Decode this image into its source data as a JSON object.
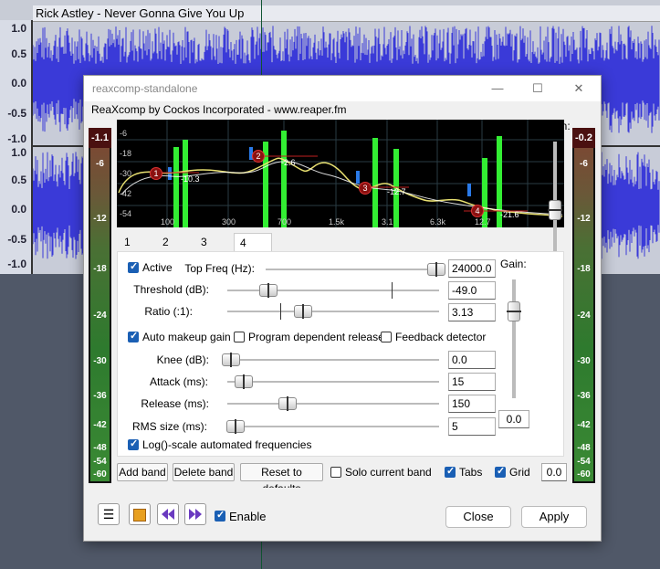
{
  "daw": {
    "track_title": "Rick Astley - Never Gonna Give You Up",
    "scale": [
      "1.0",
      "0.5",
      "0.0",
      "-0.5",
      "-1.0",
      "1.0",
      "0.5",
      "0.0",
      "-0.5",
      "-1.0"
    ]
  },
  "window": {
    "title": "reaxcomp-standalone",
    "minimize_glyph": "—",
    "maximize_glyph": "☐",
    "close_glyph": "✕",
    "subtitle": "ReaXcomp by Cockos Incorporated - www.reaper.fm"
  },
  "meters": {
    "left_top": "-1.1",
    "right_top": "-0.2",
    "labels": [
      "-6",
      "-12",
      "-18",
      "-24",
      "-30",
      "-36",
      "-42",
      "-48",
      "-54",
      "-60"
    ]
  },
  "graph": {
    "y_labels": [
      "-6",
      "-18",
      "-30",
      "-42",
      "-54"
    ],
    "x_labels": [
      "100",
      "300",
      "700",
      "1.5k",
      "3.1",
      "6.3k",
      "12.7"
    ],
    "bands": [
      {
        "num": "1",
        "value": "-10.3"
      },
      {
        "num": "2",
        "value": "-2.6"
      },
      {
        "num": "3",
        "value": "-12.7"
      },
      {
        "num": "4",
        "value": "-21.6"
      }
    ]
  },
  "gain_label": "Gain:",
  "tabs": [
    "1",
    "2",
    "3",
    "4"
  ],
  "panel": {
    "active_label": "Active",
    "active": true,
    "top_freq_label": "Top Freq (Hz):",
    "top_freq": "24000.0",
    "threshold_label": "Threshold (dB):",
    "threshold": "-49.0",
    "ratio_label": "Ratio (:1):",
    "ratio": "3.13",
    "gain_label": "Gain:",
    "band_gain": "0.0",
    "auto_makeup_label": "Auto makeup gain",
    "auto_makeup": true,
    "program_release_label": "Program dependent release",
    "program_release": false,
    "feedback_label": "Feedback detector",
    "feedback": false,
    "knee_label": "Knee (dB):",
    "knee": "0.0",
    "attack_label": "Attack (ms):",
    "attack": "15",
    "release_label": "Release (ms):",
    "release": "150",
    "rms_label": "RMS size (ms):",
    "rms": "5",
    "log_scale_label": "Log()-scale automated frequencies",
    "log_scale": true
  },
  "bottom_row": {
    "add_band": "Add band",
    "delete_band": "Delete band",
    "reset": "Reset to defaults",
    "solo_label": "Solo current band",
    "solo": false,
    "tabs_label": "Tabs",
    "tabs_checked": true,
    "grid_label": "Grid",
    "grid_checked": true,
    "master_gain": "0.0"
  },
  "footer": {
    "menu_glyph": "☰",
    "enable_label": "Enable",
    "enable": true,
    "close_label": "Close",
    "apply_label": "Apply"
  },
  "colors": {
    "accent": "#1a5fb4",
    "meter_green": "#2e7a2e",
    "graph_bg": "#000000",
    "band_node": "#b01010",
    "curve": "#e8e070"
  }
}
